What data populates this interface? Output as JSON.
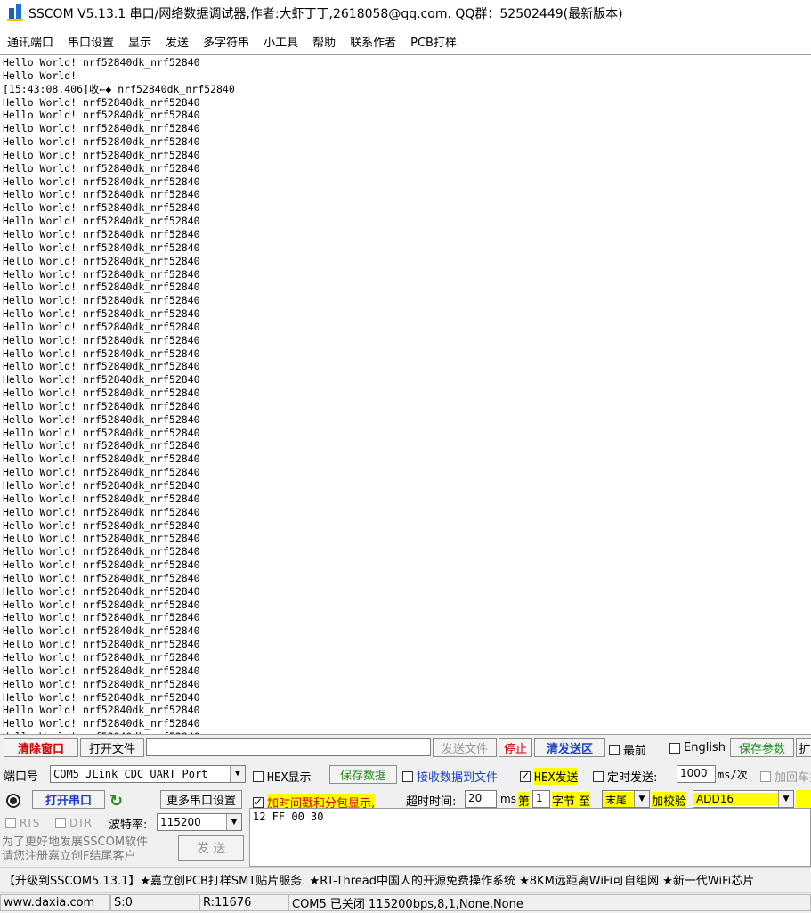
{
  "window": {
    "title": "SSCOM V5.13.1 串口/网络数据调试器,作者:大虾丁丁,2618058@qq.com. QQ群：52502449(最新版本)"
  },
  "menu": [
    "通讯端口",
    "串口设置",
    "显示",
    "发送",
    "多字符串",
    "小工具",
    "帮助",
    "联系作者",
    "PCB打样"
  ],
  "receive": {
    "lines": [
      "Hello World! nrf52840dk_nrf52840",
      "Hello World!",
      "[15:43:08.406]收←◆ nrf52840dk_nrf52840",
      "Hello World! nrf52840dk_nrf52840",
      "Hello World! nrf52840dk_nrf52840",
      "Hello World! nrf52840dk_nrf52840",
      "Hello World! nrf52840dk_nrf52840",
      "Hello World! nrf52840dk_nrf52840",
      "Hello World! nrf52840dk_nrf52840",
      "Hello World! nrf52840dk_nrf52840",
      "Hello World! nrf52840dk_nrf52840",
      "Hello World! nrf52840dk_nrf52840",
      "Hello World! nrf52840dk_nrf52840",
      "Hello World! nrf52840dk_nrf52840",
      "Hello World! nrf52840dk_nrf52840",
      "Hello World! nrf52840dk_nrf52840",
      "Hello World! nrf52840dk_nrf52840",
      "Hello World! nrf52840dk_nrf52840",
      "Hello World! nrf52840dk_nrf52840",
      "Hello World! nrf52840dk_nrf52840",
      "Hello World! nrf52840dk_nrf52840",
      "Hello World! nrf52840dk_nrf52840",
      "Hello World! nrf52840dk_nrf52840",
      "Hello World! nrf52840dk_nrf52840",
      "Hello World! nrf52840dk_nrf52840",
      "Hello World! nrf52840dk_nrf52840",
      "Hello World! nrf52840dk_nrf52840",
      "Hello World! nrf52840dk_nrf52840",
      "Hello World! nrf52840dk_nrf52840",
      "Hello World! nrf52840dk_nrf52840",
      "Hello World! nrf52840dk_nrf52840",
      "Hello World! nrf52840dk_nrf52840",
      "Hello World! nrf52840dk_nrf52840",
      "Hello World! nrf52840dk_nrf52840",
      "Hello World! nrf52840dk_nrf52840",
      "Hello World! nrf52840dk_nrf52840",
      "Hello World! nrf52840dk_nrf52840",
      "Hello World! nrf52840dk_nrf52840",
      "Hello World! nrf52840dk_nrf52840",
      "Hello World! nrf52840dk_nrf52840",
      "Hello World! nrf52840dk_nrf52840",
      "Hello World! nrf52840dk_nrf52840",
      "Hello World! nrf52840dk_nrf52840",
      "Hello World! nrf52840dk_nrf52840",
      "Hello World! nrf52840dk_nrf52840",
      "Hello World! nrf52840dk_nrf52840",
      "Hello World! nrf52840dk_nrf52840",
      "Hello World! nrf52840dk_nrf52840",
      "Hello World! nrf52840dk_nrf52840",
      "Hello World! nrf52840dk_nrf52840",
      "Hello World! nrf52840dk_nrf52840",
      "Hello World! nrf52840dk_nrf52840"
    ]
  },
  "toolbar": {
    "clear_window": "清除窗口",
    "open_file": "打开文件",
    "send_file": "发送文件",
    "stop": "停止",
    "clear_send": "清发送区",
    "topmost": "最前",
    "english": "English",
    "save_params": "保存参数",
    "expand": "扩"
  },
  "port": {
    "label": "端口号",
    "value": "COM5 JLink CDC UART Port",
    "open_button": "打开串口",
    "more_settings": "更多串口设置",
    "rts": "RTS",
    "dtr": "DTR",
    "baud_label": "波特率:",
    "baud_value": "115200"
  },
  "options": {
    "hex_display": "HEX显示",
    "save_data": "保存数据",
    "recv_to_file": "接收数据到文件",
    "hex_send": "HEX发送",
    "timed_send": "定时发送:",
    "timed_interval": "1000",
    "timed_unit": "ms/次",
    "add_crlf": "加回车换行",
    "timestamp": "加时间戳和分包显示,",
    "timeout_label": "超时时间:",
    "timeout_value": "20",
    "timeout_unit": "ms",
    "byte_from_prefix": "第",
    "byte_from_value": "1",
    "byte_from_suffix": "字节 至",
    "byte_to_value": "末尾",
    "checksum_label": "加校验",
    "checksum_value": "ADD16"
  },
  "send": {
    "content": "12 FF 00 30",
    "button": "发 送",
    "promo_line1": "为了更好地发展SSCOM软件",
    "promo_line2": "请您注册嘉立创F结尾客户"
  },
  "ticker": "【升级到SSCOM5.13.1】★嘉立创PCB打样SMT贴片服务. ★RT-Thread中国人的开源免费操作系统 ★8KM远距离WiFi可自组网 ★新一代WiFi芯片",
  "status": {
    "site": "www.daxia.com",
    "sent": "S:0",
    "received": "R:11676",
    "port_state": "COM5 已关闭  115200bps,8,1,None,None"
  }
}
